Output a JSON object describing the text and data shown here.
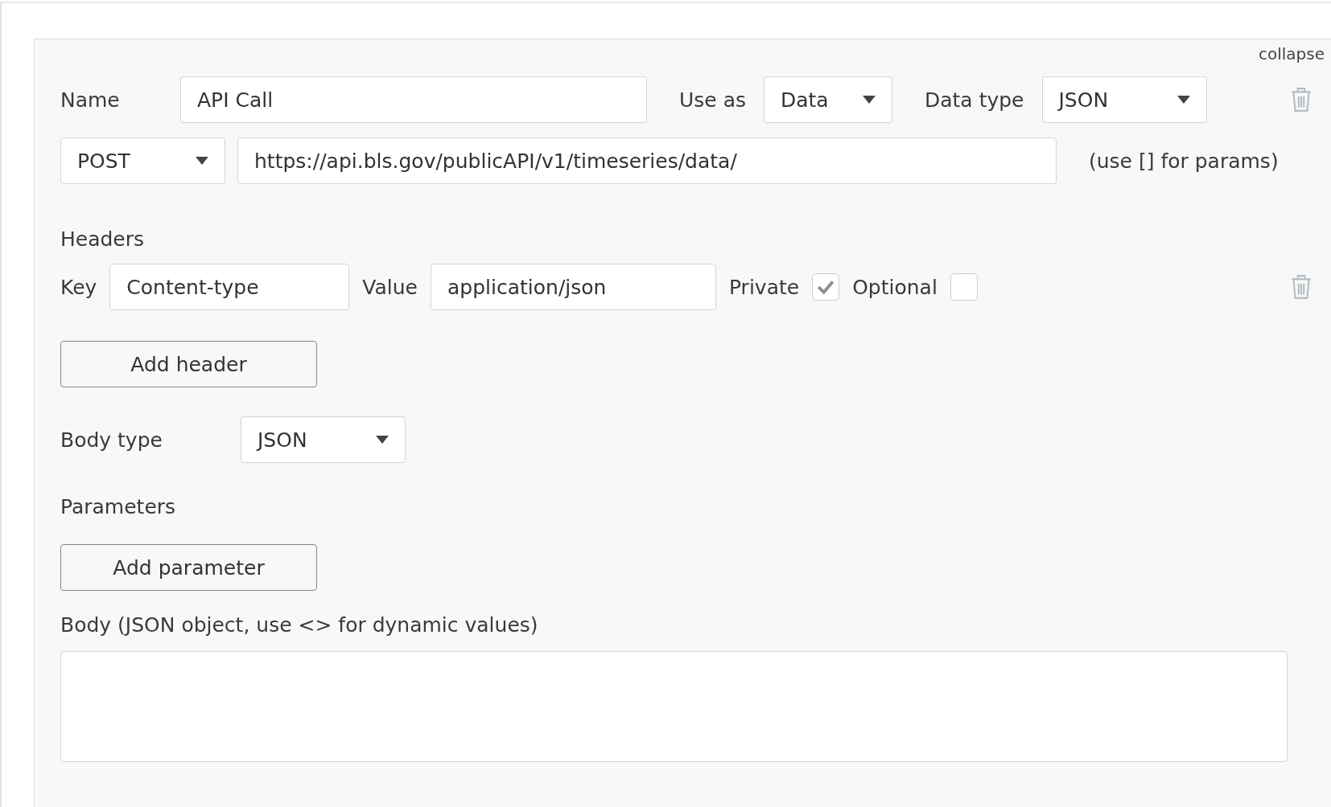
{
  "collapse_link": "collapse",
  "name_row": {
    "name_label": "Name",
    "name_value": "API Call",
    "use_as_label": "Use as",
    "use_as_value": "Data",
    "data_type_label": "Data type",
    "data_type_value": "JSON"
  },
  "request_row": {
    "method": "POST",
    "url": "https://api.bls.gov/publicAPI/v1/timeseries/data/",
    "hint": "(use [] for params)"
  },
  "headers": {
    "title": "Headers",
    "rows": [
      {
        "key_label": "Key",
        "key": "Content-type",
        "value_label": "Value",
        "value": "application/json",
        "private_label": "Private",
        "private": true,
        "optional_label": "Optional",
        "optional": false
      }
    ],
    "add_button": "Add header"
  },
  "body_type": {
    "label": "Body type",
    "value": "JSON"
  },
  "parameters": {
    "title": "Parameters",
    "add_button": "Add parameter"
  },
  "body": {
    "label": "Body (JSON object, use <> for dynamic values)"
  }
}
